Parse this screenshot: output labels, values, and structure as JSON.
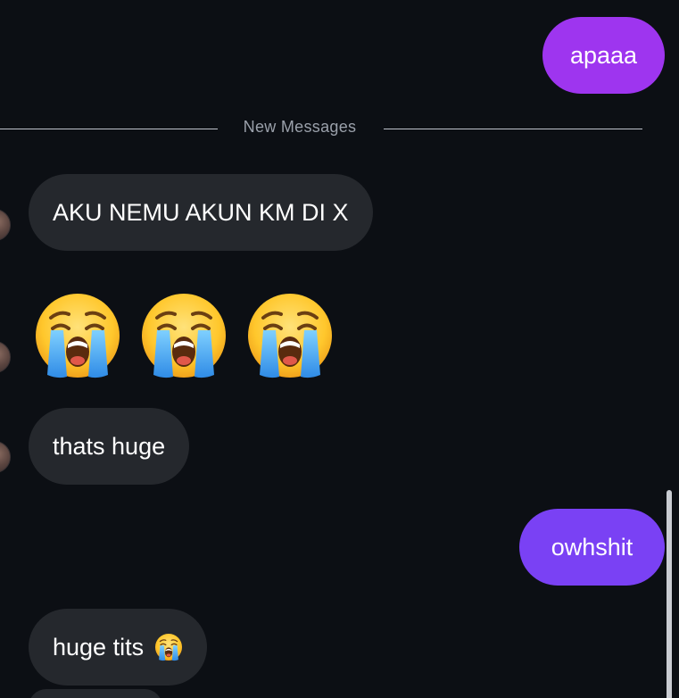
{
  "colors": {
    "background": "#0c0f14",
    "outgoing_bubble_1": "#9e35ef",
    "outgoing_bubble_2": "#7a41f4",
    "incoming_bubble": "#25282d"
  },
  "divider": {
    "label": "New Messages"
  },
  "messages": [
    {
      "direction": "outgoing",
      "text": "apaaa"
    },
    {
      "direction": "incoming",
      "text": "AKU NEMU AKUN KM DI X"
    },
    {
      "direction": "incoming",
      "emoji_icons": [
        "loudly-crying-face-icon",
        "loudly-crying-face-icon",
        "loudly-crying-face-icon"
      ]
    },
    {
      "direction": "incoming",
      "text": "thats huge"
    },
    {
      "direction": "outgoing",
      "text": "owhshit"
    },
    {
      "direction": "incoming",
      "text": "huge tits",
      "trailing_icon": "loudly-crying-face-icon"
    }
  ]
}
